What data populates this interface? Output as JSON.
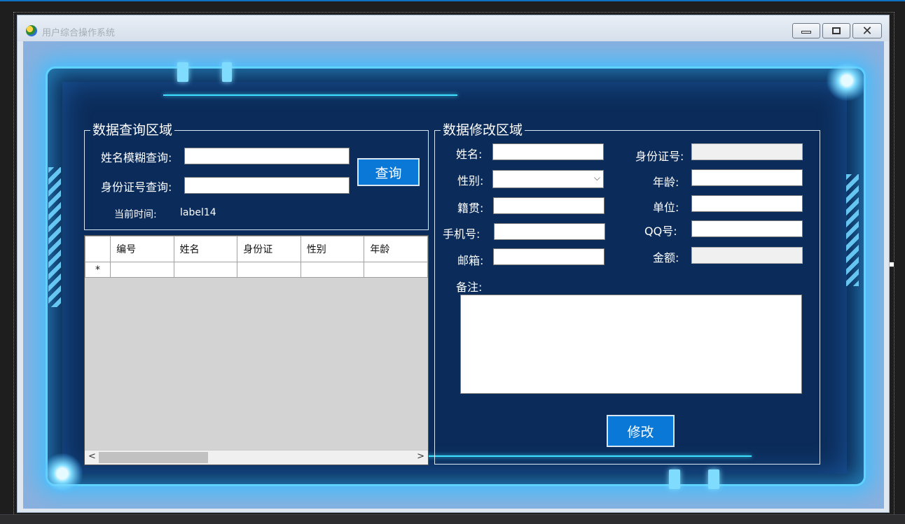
{
  "window": {
    "title": "用户综合操作系统",
    "controls": {
      "minimize": "",
      "maximize": "",
      "close": "✕"
    }
  },
  "query": {
    "group_title": "数据查询区域",
    "name_label": "姓名模糊查询:",
    "name_value": "",
    "id_label": "身份证号查询:",
    "id_value": "",
    "query_button": "查询",
    "time_label": "当前时间:",
    "time_value": "label14"
  },
  "grid": {
    "columns": [
      "编号",
      "姓名",
      "身份证",
      "性别",
      "年龄"
    ],
    "new_row_marker": "*",
    "scroll_left": "<",
    "scroll_right": ">"
  },
  "edit": {
    "group_title": "数据修改区域",
    "name_label": "姓名:",
    "gender_label": "性别:",
    "native_label": "籍贯:",
    "phone_label": "手机号:",
    "email_label": "邮箱:",
    "idcard_label": "身份证号:",
    "age_label": "年龄:",
    "unit_label": "单位:",
    "qq_label": "QQ号:",
    "amount_label": "金额:",
    "remark_label": "备注:",
    "gender_value": "",
    "modify_button": "修改"
  },
  "colors": {
    "panel": "#0b2c5a",
    "glow": "#5fd3ff",
    "button": "#0a78d7"
  }
}
